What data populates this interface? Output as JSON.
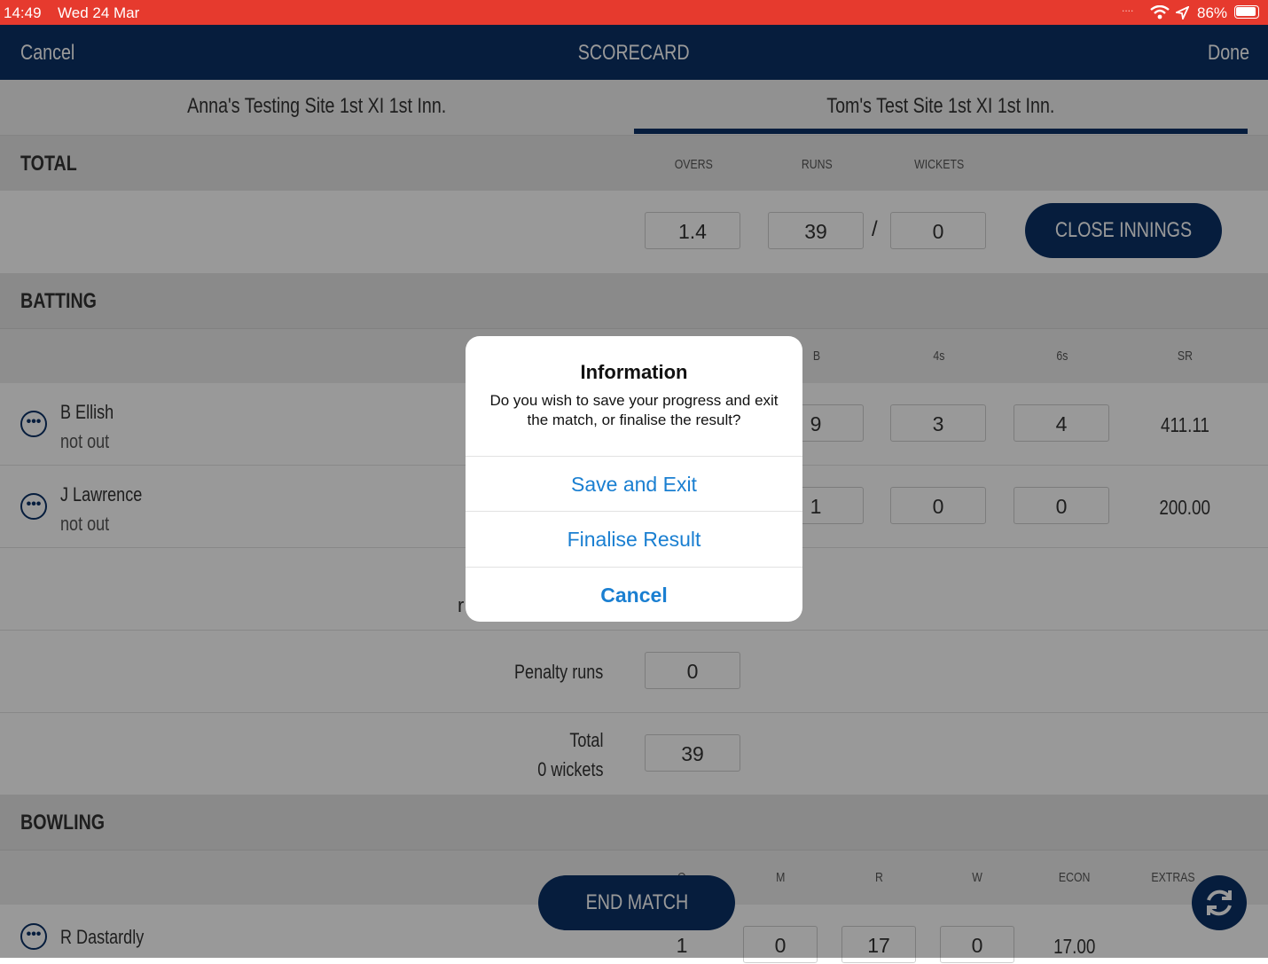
{
  "status_bar": {
    "time": "14:49",
    "date": "Wed 24 Mar",
    "battery": "86%"
  },
  "nav": {
    "cancel": "Cancel",
    "title": "SCORECARD",
    "done": "Done"
  },
  "tabs": [
    {
      "label": "Anna's Testing Site 1st XI 1st Inn."
    },
    {
      "label": "Tom's Test Site 1st XI 1st Inn."
    }
  ],
  "total": {
    "title": "TOTAL",
    "headers": {
      "overs": "OVERS",
      "runs": "RUNS",
      "wickets": "WICKETS"
    },
    "overs": "1.4",
    "runs": "39",
    "separator": "/",
    "wickets": "0",
    "close_button": "CLOSE INNINGS"
  },
  "batting": {
    "title": "BATTING",
    "headers": {
      "b": "B",
      "fours": "4s",
      "sixes": "6s",
      "sr": "SR"
    },
    "rows": [
      {
        "name": "B Ellish",
        "status": "not out",
        "b": "9",
        "fours": "3",
        "sixes": "4",
        "sr": "411.11"
      },
      {
        "name": "J Lawrence",
        "status": "not out",
        "b": "1",
        "fours": "0",
        "sixes": "0",
        "sr": "200.00"
      }
    ],
    "partial_label": "r",
    "penalty_label": "Penalty runs",
    "penalty_value": "0",
    "total_label": "Total",
    "total_wickets": "0 wickets",
    "total_value": "39"
  },
  "bowling": {
    "title": "BOWLING",
    "headers": {
      "o": "O",
      "m": "M",
      "r": "R",
      "w": "W",
      "econ": "ECON",
      "extras": "EXTRAS"
    },
    "rows": [
      {
        "name": "R Dastardly",
        "o": "1",
        "m": "0",
        "r": "17",
        "w": "0",
        "econ": "17.00"
      }
    ]
  },
  "end_match_button": "END MATCH",
  "dialog": {
    "title": "Information",
    "message": "Do you wish to save your progress and exit the match, or finalise the result?",
    "actions": [
      "Save and Exit",
      "Finalise Result",
      "Cancel"
    ]
  },
  "colors": {
    "navy": "#0b3166",
    "status_red": "#e63a2e",
    "action_blue": "#1a7fd1"
  }
}
